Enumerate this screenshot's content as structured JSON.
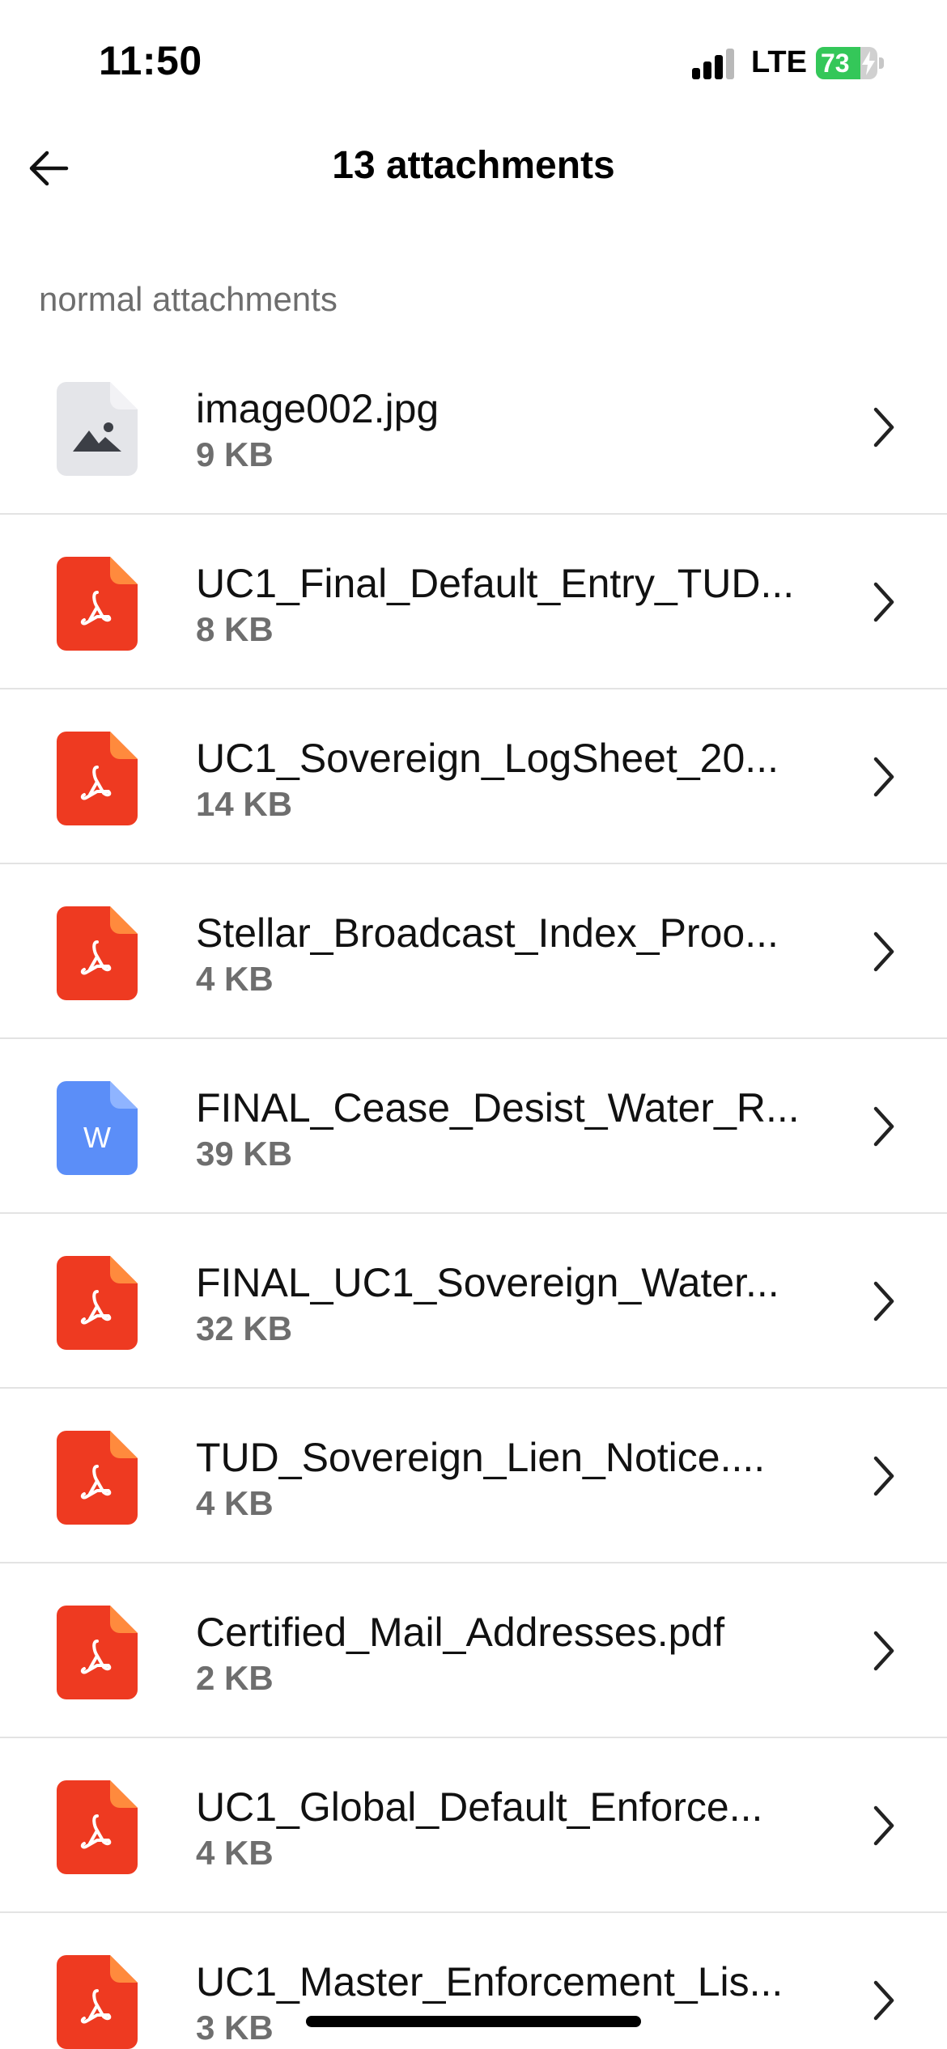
{
  "status_bar": {
    "time": "11:50",
    "network": "LTE",
    "battery_percent": "73",
    "battery_level": 0.73,
    "battery_color": "#34c759",
    "signal_bars": 3,
    "signal_bars_total": 4
  },
  "header": {
    "back_icon": "arrow-left-icon",
    "title": "13 attachments"
  },
  "section": {
    "label": "normal attachments"
  },
  "colors": {
    "pdf": "#ee3a21",
    "pdf_fold": "#ff8a3d",
    "word": "#5b8ef8",
    "word_fold": "#8fb4ff",
    "image": "#e4e5e9",
    "image_fold": "#f2f2f5",
    "image_glyph": "#3c3f46"
  },
  "attachments": [
    {
      "name": "image002.jpg",
      "size": "9 KB",
      "type": "image",
      "icon": "image-file-icon"
    },
    {
      "name": "UC1_Final_Default_Entry_TUD...",
      "size": "8 KB",
      "type": "pdf",
      "icon": "pdf-file-icon"
    },
    {
      "name": "UC1_Sovereign_LogSheet_20...",
      "size": "14 KB",
      "type": "pdf",
      "icon": "pdf-file-icon"
    },
    {
      "name": "Stellar_Broadcast_Index_Proo...",
      "size": "4 KB",
      "type": "pdf",
      "icon": "pdf-file-icon"
    },
    {
      "name": "FINAL_Cease_Desist_Water_R...",
      "size": "39 KB",
      "type": "word",
      "icon": "word-file-icon",
      "letter": "W"
    },
    {
      "name": "FINAL_UC1_Sovereign_Water...",
      "size": "32 KB",
      "type": "pdf",
      "icon": "pdf-file-icon"
    },
    {
      "name": "TUD_Sovereign_Lien_Notice....",
      "size": "4 KB",
      "type": "pdf",
      "icon": "pdf-file-icon"
    },
    {
      "name": "Certified_Mail_Addresses.pdf",
      "size": "2 KB",
      "type": "pdf",
      "icon": "pdf-file-icon"
    },
    {
      "name": "UC1_Global_Default_Enforce...",
      "size": "4 KB",
      "type": "pdf",
      "icon": "pdf-file-icon"
    },
    {
      "name": "UC1_Master_Enforcement_Lis...",
      "size": "3 KB",
      "type": "pdf",
      "icon": "pdf-file-icon"
    }
  ]
}
